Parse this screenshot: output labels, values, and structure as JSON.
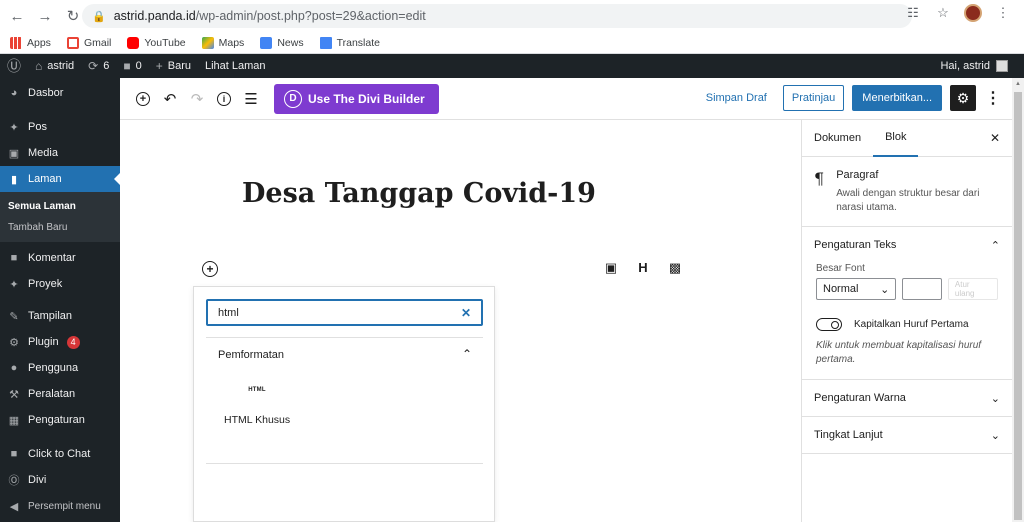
{
  "browser": {
    "url_host": "astrid.panda.id",
    "url_path": "/wp-admin/post.php?post=29&action=edit",
    "bookmarks": [
      "Apps",
      "Gmail",
      "YouTube",
      "Maps",
      "News",
      "Translate"
    ]
  },
  "adminbar": {
    "site_name": "astrid",
    "updates": "6",
    "comments": "0",
    "new_label": "Baru",
    "view_label": "Lihat Laman",
    "greeting": "Hai, astrid"
  },
  "sidebar": {
    "items": [
      {
        "label": "Dasbor"
      },
      {
        "label": "Pos"
      },
      {
        "label": "Media"
      },
      {
        "label": "Laman"
      },
      {
        "label": "Komentar"
      },
      {
        "label": "Proyek"
      },
      {
        "label": "Tampilan"
      },
      {
        "label": "Plugin"
      },
      {
        "label": "Pengguna"
      },
      {
        "label": "Peralatan"
      },
      {
        "label": "Pengaturan"
      },
      {
        "label": "Click to Chat"
      },
      {
        "label": "Divi"
      },
      {
        "label": "Persempit menu"
      }
    ],
    "submenu": [
      "Semua Laman",
      "Tambah Baru"
    ],
    "plugin_badge": "4"
  },
  "toolbar": {
    "divi_button": "Use The Divi Builder",
    "divi_logo": "D",
    "save_draft": "Simpan Draf",
    "preview": "Pratinjau",
    "publish": "Menerbitkan..."
  },
  "editor": {
    "title": "Desa Tanggap Covid-19"
  },
  "inserter": {
    "search_value": "html",
    "category": "Pemformatan",
    "block_icon_text": "HTML",
    "block_label": "HTML Khusus"
  },
  "settings": {
    "tabs": [
      "Dokumen",
      "Blok"
    ],
    "block_title": "Paragraf",
    "block_desc": "Awali dengan struktur besar dari narasi utama.",
    "text_settings": "Pengaturan Teks",
    "font_size_label": "Besar Font",
    "font_size_value": "Normal",
    "reset_label": "Atur ulang",
    "dropcap_label": "Kapitalkan Huruf Pertama",
    "dropcap_help": "Klik untuk membuat kapitalisasi huruf pertama.",
    "color_settings": "Pengaturan Warna",
    "advanced": "Tingkat Lanjut"
  },
  "colors": {
    "admin_dark": "#1d2327",
    "accent_blue": "#2271b1",
    "divi_purple": "#7e3bd0"
  }
}
